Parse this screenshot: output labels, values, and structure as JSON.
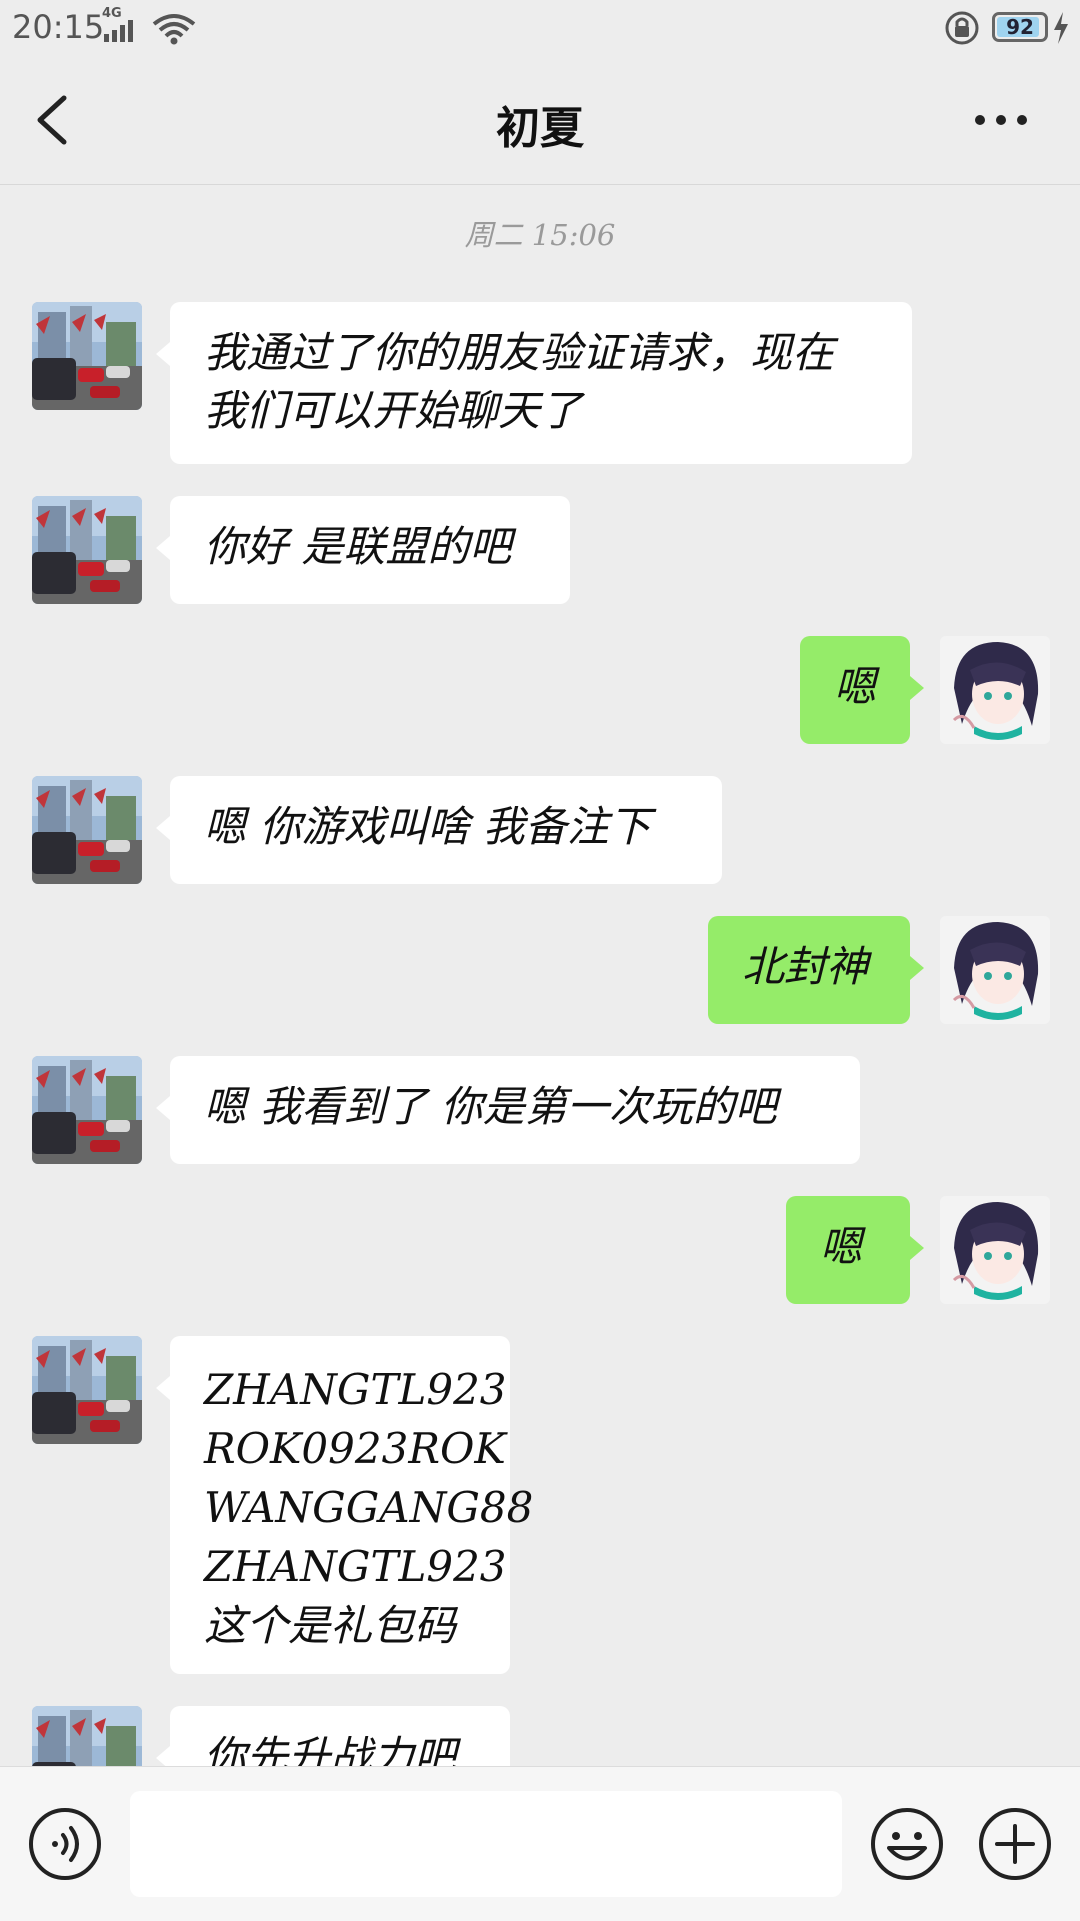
{
  "status_bar": {
    "time": "20:15",
    "network": "4G",
    "battery": "92",
    "battery_level": 0.92
  },
  "header": {
    "title": "初夏"
  },
  "chat": {
    "time_divider": "周二 15:06",
    "messages": [
      {
        "side": "left",
        "text": "我通过了你的朋友验证请求，现在\n我们可以开始聊天了"
      },
      {
        "side": "left",
        "text": "你好 是联盟的吧"
      },
      {
        "side": "right",
        "text": "嗯"
      },
      {
        "side": "left",
        "text": "嗯 你游戏叫啥 我备注下"
      },
      {
        "side": "right",
        "text": "北封神"
      },
      {
        "side": "left",
        "text": "嗯 我看到了 你是第一次玩的吧"
      },
      {
        "side": "right",
        "text": "嗯"
      },
      {
        "side": "left",
        "text": "ZHANGTL923\nROK0923ROK\nWANGGANG88\nZHANGTL923\n这个是礼包码"
      },
      {
        "side": "left",
        "text": "你先升战力吧"
      }
    ]
  },
  "input_bar": {
    "value": "",
    "placeholder": ""
  },
  "icons": {
    "back": "chevron-left-icon",
    "more": "more-horizontal-icon",
    "voice": "voice-icon",
    "emoji": "emoji-icon",
    "plus": "plus-icon"
  },
  "colors": {
    "background": "#ededed",
    "sent_bubble": "#95ec69",
    "received_bubble": "#ffffff"
  }
}
